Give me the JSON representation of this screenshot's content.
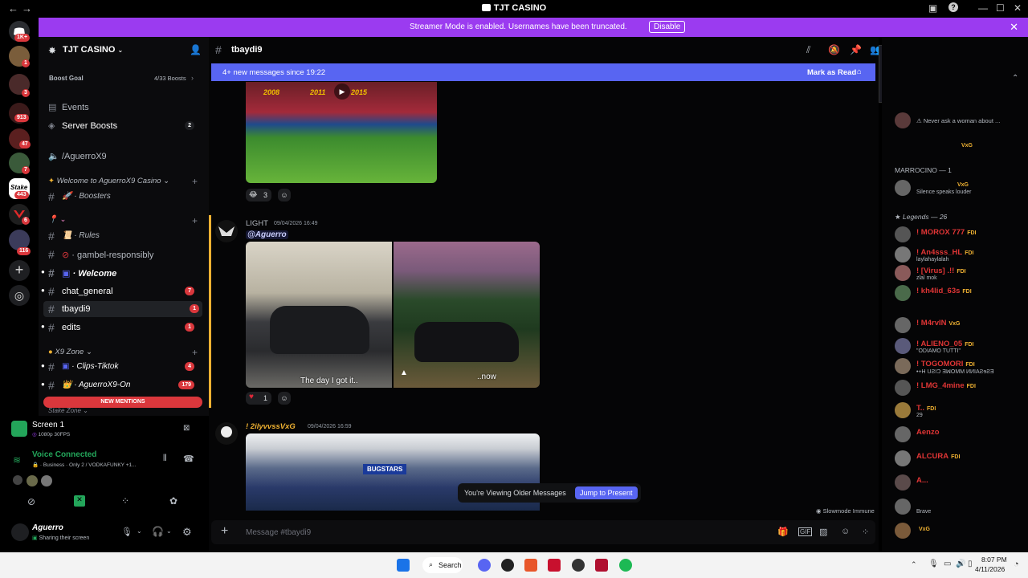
{
  "window": {
    "title": "TJT CASINO",
    "back": "←",
    "forward": "→",
    "minimize": "—",
    "maximize": "☐",
    "close": "✕",
    "help": "?"
  },
  "rail": {
    "badges": [
      "1K+",
      "1",
      "3",
      "913",
      "47",
      "7",
      "443",
      "6",
      "116"
    ]
  },
  "banner": {
    "text": "Streamer Mode is enabled. Usernames have been truncated.",
    "button": "Disable",
    "close": "✕"
  },
  "sidebar": {
    "guild_name": "TJT CASINO",
    "boost_goal": "Boost Goal",
    "boost_count": "4/33 Boosts",
    "events": "Events",
    "server_boosts": "Server Boosts",
    "server_boosts_badge": "2",
    "voice_aguerro": "/AguerroX9",
    "cat_welcome": "Welcome to AguerroX9 Casino",
    "boosters": "Boosters",
    "rules": "Rules",
    "gambel": "gambel-responsibly",
    "welcome": "Welcome",
    "chat_general": "chat_general",
    "chat_general_badge": "7",
    "tbaydi9": "tbaydi9",
    "tbaydi9_badge": "1",
    "edits": "edits",
    "edits_badge": "1",
    "cat_x9": "X9 Zone",
    "clips": "Clips-Tiktok",
    "clips_badge": "4",
    "aguerro_on": "AguerroX9-On",
    "aguerro_on_badge": "179",
    "new_mentions": "NEW MENTIONS",
    "stake_zone": "Stake Zone"
  },
  "voice": {
    "screen_title": "Screen 1",
    "screen_sub": "1080p 30FPS",
    "connected": "Voice Connected",
    "channel": "Business · Only 2 / VODKAFUNKY +1...",
    "user": "Aguerro",
    "user_status": "Sharing their screen"
  },
  "chat": {
    "channel": "tbaydi9",
    "new_messages": "4+ new messages since 19:22",
    "mark_read": "Mark as Read",
    "msg1_reaction_count": "3",
    "msg2_author": "LIGHT",
    "msg2_time": "09/04/2026 16:49",
    "msg2_mention": "@Aguerro",
    "img_caption1": "The day I got it..",
    "img_caption2": "..now",
    "msg2_reaction_count": "1",
    "msg3_author": "! 2ilyvvssVxG",
    "msg3_time": "09/04/2026 16:59",
    "older_text": "You're Viewing Older Messages",
    "jump_button": "Jump to Present",
    "slowmode": "Slowmode Immune",
    "composer_placeholder": "Message #tbaydi9",
    "stadium_years": [
      "2008",
      "2011",
      "2015"
    ],
    "storefront_sign": "BUGSTARS"
  },
  "members": {
    "top_status": "Never ask a woman about ...",
    "top_tag": "VxG",
    "marrocino_header": "MARROCINO — 1",
    "marrocino_tag": "VxG",
    "marrocino_status": "Silence speaks louder",
    "legends_header": "Legends — 26",
    "list": [
      {
        "name": "! MOROX 777",
        "tag": "FDI",
        "status": "",
        "color": "#e03535"
      },
      {
        "name": "! An4sss_HL",
        "tag": "FDI",
        "status": "laylahaylalah",
        "color": "#e03535"
      },
      {
        "name": "! [Virus] .!!",
        "tag": "FDI",
        "status": "zlal mok",
        "color": "#e03535"
      },
      {
        "name": "! kh4lid_63s",
        "tag": "FDI",
        "status": "",
        "color": "#e03535"
      },
      {
        "name": "! M4rvIN",
        "tag": "VxG",
        "status": "",
        "color": "#e03535"
      },
      {
        "name": "! ALIENO_05",
        "tag": "FDI",
        "status": "\"ODIAMO TUTTI\"",
        "color": "#e03535"
      },
      {
        "name": "! TOGOMORI",
        "tag": "FDI",
        "status": "•+H UƧIƆ ƎꟽOMM ИИIAƧɘƧƎ",
        "color": "#e03535"
      },
      {
        "name": "! LMG_4mine",
        "tag": "FDI",
        "status": "",
        "color": "#e03535"
      },
      {
        "name": "T..",
        "tag": "FDI",
        "status": "29",
        "color": "#e03535"
      },
      {
        "name": "Aenzo",
        "tag": "",
        "status": "",
        "color": "#e03535"
      },
      {
        "name": "ALCURA",
        "tag": "FDI",
        "status": "",
        "color": "#e03535"
      },
      {
        "name": "A...",
        "tag": "",
        "status": "",
        "color": "#e03535"
      },
      {
        "name": "",
        "tag": "",
        "status": "Brave",
        "color": "#e03535"
      },
      {
        "name": "",
        "tag": "VxG",
        "status": "",
        "color": "#e03535"
      }
    ]
  },
  "taskbar": {
    "search": "Search",
    "time": "8:07 PM",
    "date": "4/11/2026"
  }
}
